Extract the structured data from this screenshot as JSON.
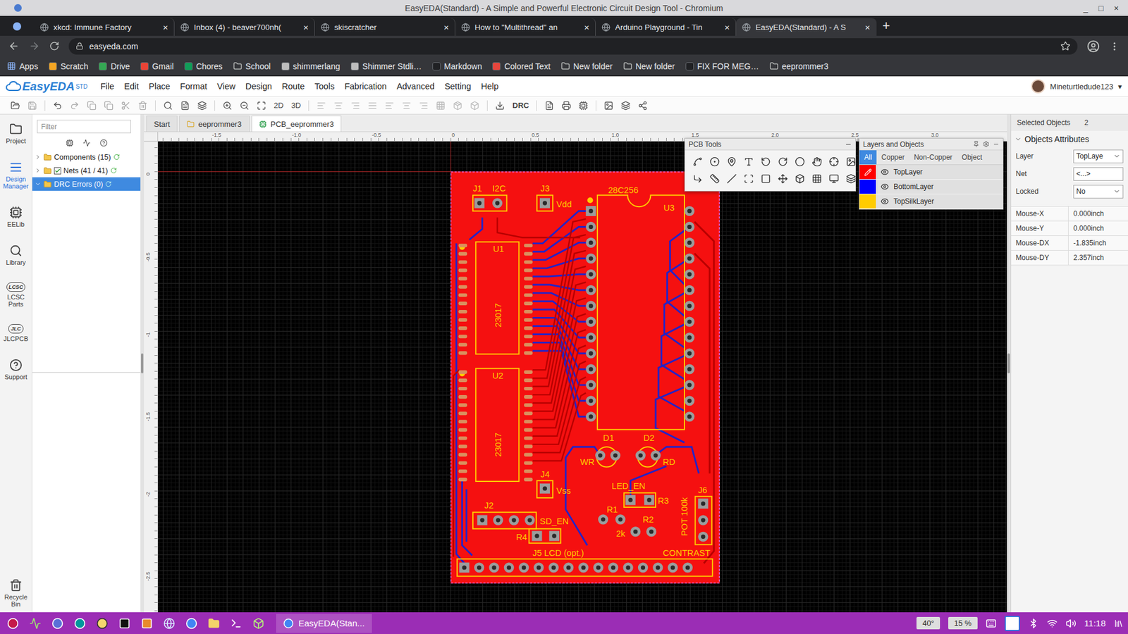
{
  "window": {
    "title": "EasyEDA(Standard) - A Simple and Powerful Electronic Circuit Design Tool - Chromium",
    "controls": [
      "_",
      "□",
      "×"
    ]
  },
  "browser": {
    "tabs": [
      {
        "label": "xkcd: Immune Factory",
        "selected": false
      },
      {
        "label": "Inbox (4) - beaver700nh(",
        "selected": false
      },
      {
        "label": "skiscratcher",
        "selected": false
      },
      {
        "label": "How to \"Multithread\" an",
        "selected": false
      },
      {
        "label": "Arduino Playground - Tin",
        "selected": false
      },
      {
        "label": "EasyEDA(Standard) - A S",
        "selected": true
      }
    ],
    "tab_close": "×",
    "new_tab": "+",
    "address": "easyeda.com",
    "bookmarks": [
      {
        "label": "Apps",
        "kind": "apps",
        "color": "#8ab4f8"
      },
      {
        "label": "Scratch",
        "kind": "site",
        "color": "#f5a623"
      },
      {
        "label": "Drive",
        "kind": "site",
        "color": "#34a853"
      },
      {
        "label": "Gmail",
        "kind": "site",
        "color": "#ea4335"
      },
      {
        "label": "Chores",
        "kind": "site",
        "color": "#0f9d58"
      },
      {
        "label": "School",
        "kind": "folder",
        "color": "#c4c7c5"
      },
      {
        "label": "shimmerlang",
        "kind": "site",
        "color": "#bdbdbd"
      },
      {
        "label": "Shimmer Stdli…",
        "kind": "site",
        "color": "#bdbdbd"
      },
      {
        "label": "Markdown",
        "kind": "site",
        "color": "#202124"
      },
      {
        "label": "Colored Text",
        "kind": "site",
        "color": "#e8453c"
      },
      {
        "label": "New folder",
        "kind": "folder",
        "color": "#c4c7c5"
      },
      {
        "label": "New folder",
        "kind": "folder",
        "color": "#c4c7c5"
      },
      {
        "label": "FIX FOR MEG…",
        "kind": "site",
        "color": "#202124"
      },
      {
        "label": "eeprommer3",
        "kind": "folder",
        "color": "#c4c7c5"
      }
    ]
  },
  "editor": {
    "logo": {
      "name": "EasyEDA",
      "edition": "STD"
    },
    "menus": [
      "File",
      "Edit",
      "Place",
      "Format",
      "View",
      "Design",
      "Route",
      "Tools",
      "Fabrication",
      "Advanced",
      "Setting",
      "Help"
    ],
    "user": "Mineturtledude123",
    "user_caret": "▾",
    "view_modes": [
      "2D",
      "3D"
    ],
    "drc": "DRC"
  },
  "rail": {
    "items": [
      {
        "label": "Project",
        "selected": false,
        "kind": "project",
        "badge": ""
      },
      {
        "label": "Design Manager",
        "selected": true,
        "kind": "manager",
        "badge": ""
      },
      {
        "label": "EELib",
        "selected": false,
        "kind": "eelib",
        "badge": ""
      },
      {
        "label": "Library",
        "selected": false,
        "kind": "library",
        "badge": ""
      },
      {
        "label": "LCSC Parts",
        "selected": false,
        "kind": "badge",
        "badge": "LCSC"
      },
      {
        "label": "JLCPCB",
        "selected": false,
        "kind": "badge",
        "badge": "JLC"
      },
      {
        "label": "Support",
        "selected": false,
        "kind": "support",
        "badge": ""
      }
    ],
    "bottom": {
      "label": "Recycle Bin"
    }
  },
  "design_manager": {
    "filter_placeholder": "Filter",
    "tree": [
      {
        "label": "Components (15)",
        "kind": "folder",
        "expanded": false,
        "checked": false,
        "selected": false
      },
      {
        "label": "Nets (41 / 41)",
        "kind": "checkbox",
        "expanded": false,
        "checked": true,
        "selected": false
      },
      {
        "label": "DRC Errors (0)",
        "kind": "folder",
        "expanded": true,
        "checked": false,
        "selected": true
      }
    ]
  },
  "doc_tabs": [
    {
      "label": "Start",
      "kind": "start",
      "selected": false
    },
    {
      "label": "eeprommer3",
      "kind": "project",
      "selected": false
    },
    {
      "label": "PCB_eeprommer3",
      "kind": "pcb",
      "selected": true
    }
  ],
  "rulers": {
    "x": [
      "-1.5",
      "-1.0",
      "-0.5",
      "0",
      "0.5",
      "1.0",
      "1.5",
      "2.0",
      "2.5",
      "3.0"
    ],
    "y": [
      "0",
      "-0.5",
      "-1",
      "-1.5",
      "-2",
      "-2.5"
    ]
  },
  "pcb": {
    "labels": [
      "J1",
      "I2C",
      "J3",
      "Vdd",
      "28C256",
      "U3",
      "U1",
      "23017",
      "U2",
      "23017",
      "D1",
      "D2",
      "WR",
      "RD",
      "LED_EN",
      "R3",
      "R1",
      "R2",
      "2k",
      "POT 100k",
      "J6",
      "J4",
      "Vss",
      "J2",
      "SD_EN",
      "R4",
      "J5 LCD (opt.)",
      "CONTRAST"
    ]
  },
  "pcb_tools": {
    "title": "PCB Tools"
  },
  "layers_panel": {
    "title": "Layers and Objects",
    "tabs": [
      {
        "label": "All",
        "selected": true
      },
      {
        "label": "Copper",
        "selected": false
      },
      {
        "label": "Non-Copper",
        "selected": false
      },
      {
        "label": "Object",
        "selected": false
      }
    ],
    "layers": [
      {
        "name": "TopLayer",
        "color": "#ff0000",
        "active": true,
        "visible": true
      },
      {
        "name": "BottomLayer",
        "color": "#0000ff",
        "active": false,
        "visible": true
      },
      {
        "name": "TopSilkLayer",
        "color": "#ffcc00",
        "active": false,
        "visible": true
      }
    ]
  },
  "properties": {
    "selected_label": "Selected Objects",
    "selected_count": "2",
    "section": "Objects Attributes",
    "fields": [
      {
        "label": "Layer",
        "value": "TopLaye",
        "kind": "select"
      },
      {
        "label": "Net",
        "value": "<...>",
        "kind": "input"
      },
      {
        "label": "Locked",
        "value": "No",
        "kind": "select"
      }
    ],
    "readouts": [
      {
        "label": "Mouse-X",
        "value": "0.000inch"
      },
      {
        "label": "Mouse-Y",
        "value": "0.000inch"
      },
      {
        "label": "Mouse-DX",
        "value": "-1.835inch"
      },
      {
        "label": "Mouse-DY",
        "value": "2.357inch"
      }
    ]
  },
  "taskbar": {
    "task": "EasyEDA(Stan...",
    "temp": "40°",
    "cpu": "15 %",
    "clock": "11:18"
  }
}
